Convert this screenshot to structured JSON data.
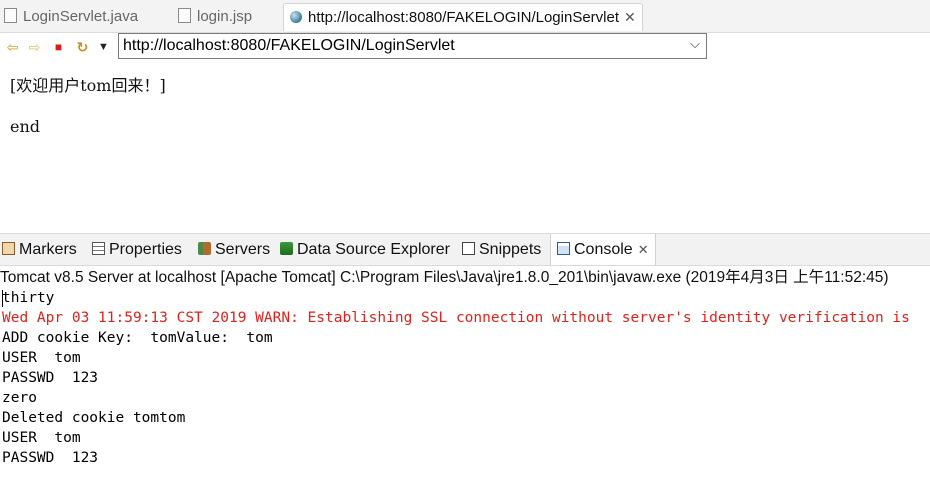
{
  "editor_tabs": [
    {
      "label": "LoginServlet.java",
      "icon": "java-file-icon"
    },
    {
      "label": "login.jsp",
      "icon": "jsp-file-icon"
    },
    {
      "label": "http://localhost:8080/FAKELOGIN/LoginServlet",
      "icon": "globe-icon",
      "close": "✕"
    }
  ],
  "toolbar": {
    "back_icon": "⇦",
    "forward_icon": "⇨",
    "stop_icon": "■",
    "refresh_icon": "↻",
    "menu_icon": "▼",
    "url": "http://localhost:8080/FAKELOGIN/LoginServlet",
    "dropdown_icon": "⌵"
  },
  "page": {
    "welcome": "[欢迎用户tom回来！]",
    "end": "end"
  },
  "views": {
    "tabs": [
      {
        "label": "Markers"
      },
      {
        "label": "Properties"
      },
      {
        "label": "Servers"
      },
      {
        "label": "Data Source Explorer"
      },
      {
        "label": "Snippets"
      },
      {
        "label": "Console",
        "close": "✕"
      }
    ]
  },
  "console": {
    "header": "Tomcat v8.5 Server at localhost [Apache Tomcat] C:\\Program Files\\Java\\jre1.8.0_201\\bin\\javaw.exe (2019年4月3日 上午11:52:45)",
    "lines": [
      "thirty",
      "Wed Apr 03 11:59:13 CST 2019 WARN: Establishing SSL connection without server's identity verification is",
      "ADD cookie Key:  tomValue:  tom",
      "USER  tom",
      "PASSWD  123",
      "zero",
      "Deleted cookie tomtom",
      "USER  tom",
      "PASSWD  123"
    ]
  },
  "colors": {
    "warning_text": "#e0221c",
    "globe": "#3d7a99"
  }
}
